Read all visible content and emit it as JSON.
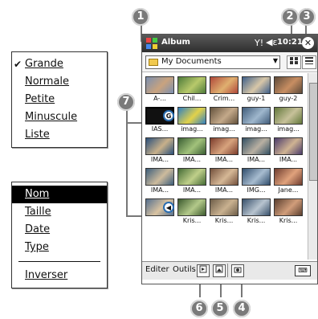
{
  "callouts": [
    "1",
    "2",
    "3",
    "4",
    "5",
    "6",
    "7"
  ],
  "size_menu": {
    "items": [
      {
        "label": "Grande",
        "checked": true
      },
      {
        "label": "Normale"
      },
      {
        "label": "Petite"
      },
      {
        "label": "Minuscule"
      },
      {
        "label": "Liste"
      }
    ]
  },
  "sort_menu": {
    "items": [
      {
        "label": "Nom",
        "selected": true
      },
      {
        "label": "Taille"
      },
      {
        "label": "Date"
      },
      {
        "label": "Type"
      }
    ],
    "after_separator": {
      "label": "Inverser"
    }
  },
  "titlebar": {
    "app_title": "Album",
    "signal": "Y!",
    "speaker": "◀ε",
    "time": "10:21",
    "close": "✕"
  },
  "toolbar": {
    "folder": "My Documents",
    "button2_icon": "grid-view-icon",
    "button3_icon": "list-view-icon"
  },
  "thumbnails": [
    [
      "A-...",
      "Chil...",
      "Crim...",
      "guy-1",
      "guy-2"
    ],
    [
      "IAS...",
      "imag...",
      "imag...",
      "imag...",
      "imag..."
    ],
    [
      "IMA...",
      "IMA...",
      "IMA...",
      "IMA...",
      "IMA..."
    ],
    [
      "IMA...",
      "IMA...",
      "IMA...",
      "IMG...",
      "Jane..."
    ],
    [
      "",
      "Kris...",
      "Kris...",
      "Kris...",
      "Kris..."
    ]
  ],
  "menubar": {
    "edit": "Editer",
    "tools": "Outils"
  }
}
